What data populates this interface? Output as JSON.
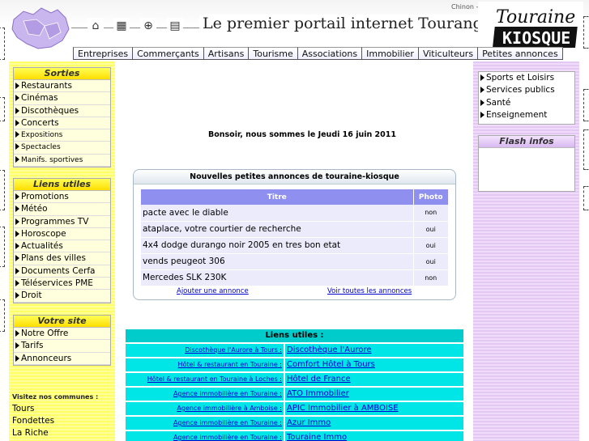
{
  "header": {
    "title": "Le premier portail internet Tourangeau",
    "top_right_text": "Chinon - Amboise",
    "brand_top": "Touraine",
    "brand_bottom": "KIOSQUE",
    "icons": [
      "home-icon",
      "calculator-icon",
      "search-icon",
      "document-icon"
    ]
  },
  "nav": {
    "items": [
      "Entreprises",
      "Commerçants",
      "Artisans",
      "Tourisme",
      "Associations",
      "Immobilier",
      "Viticulteurs",
      "Petites annonces"
    ]
  },
  "sorties": {
    "title": "Sorties",
    "items": [
      "Restaurants",
      "Cinémas",
      "Discothèques",
      "Concerts",
      "Expositions",
      "Spectacles",
      "Manifs. sportives"
    ]
  },
  "liens_utiles_menu": {
    "title": "Liens utiles",
    "items": [
      "Promotions",
      "Météo",
      "Programmes TV",
      "Horoscope",
      "Actualités",
      "Plans des villes",
      "Documents Cerfa",
      "Téléservices PME",
      "Droit"
    ]
  },
  "votre_site": {
    "title": "Votre site",
    "items": [
      "Notre Offre",
      "Tarifs",
      "Annonceurs"
    ]
  },
  "communes": {
    "title": "Visitez nos communes :",
    "items": [
      "Tours",
      "Fondettes",
      "La Riche"
    ]
  },
  "right_menu": {
    "items": [
      "Sports et Loisirs",
      "Services publics",
      "Santé",
      "Enseignement"
    ]
  },
  "flash": {
    "title": "Flash infos"
  },
  "greeting": "Bonsoir, nous sommes le Jeudi 16 juin 2011",
  "petites_annonces": {
    "title": "Nouvelles petites annonces de touraine-kiosque",
    "col_titre": "Titre",
    "col_photo": "Photo",
    "rows": [
      {
        "titre": "pacte avec le diable",
        "photo": "non"
      },
      {
        "titre": "ataplace, votre courtier de recherche",
        "photo": "oui"
      },
      {
        "titre": "4x4 dodge durango noir 2005 en tres bon etat",
        "photo": "oui"
      },
      {
        "titre": "vends peugeot 306",
        "photo": "oui"
      },
      {
        "titre": "Mercedes SLK 230K",
        "photo": "non"
      }
    ],
    "add_link": "Ajouter une annonce",
    "all_link": "Voir toutes les annonces"
  },
  "liens_table": {
    "title": "Liens utiles :",
    "rows": [
      {
        "cat": "Discothèque l'Aurore à Tours",
        "name": "Discothèque l'Aurore"
      },
      {
        "cat": "Hôtel & restaurant en Touraine",
        "name": "Comfort Hôtel à Tours"
      },
      {
        "cat": "Hôtel & restaurant en Touraine à Loches",
        "name": "Hôtel de France"
      },
      {
        "cat": "Agence immobilière en Touraine",
        "name": "ATO Immobilier"
      },
      {
        "cat": "Agence immobilière à Amboise",
        "name": "APIC Immobilier à AMBOISE"
      },
      {
        "cat": "Agence immobilière en Touraine",
        "name": "Azur Immo"
      },
      {
        "cat": "Agence immobilière en Touraine",
        "name": "Touraine Immo"
      }
    ]
  }
}
